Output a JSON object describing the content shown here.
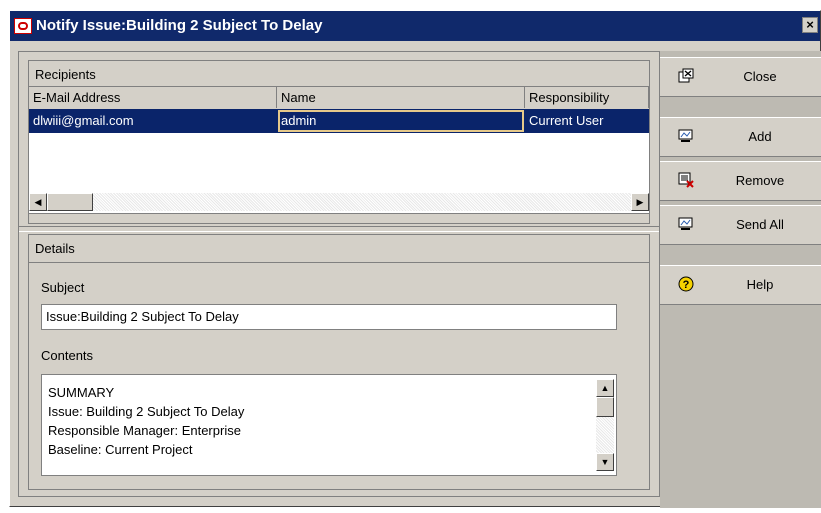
{
  "window": {
    "title": "Notify Issue:Building 2 Subject To Delay"
  },
  "recipients": {
    "header": "Recipients",
    "columns": [
      "E-Mail Address",
      "Name",
      "Responsibility"
    ],
    "rows": [
      {
        "email": "dlwiii@gmail.com",
        "name": "admin",
        "responsibility": "Current User"
      }
    ]
  },
  "details": {
    "header": "Details",
    "subject_label": "Subject",
    "subject_value": "Issue:Building 2 Subject To Delay",
    "contents_label": "Contents",
    "contents_lines": [
      "SUMMARY",
      "Issue:  Building 2 Subject To Delay",
      "Responsible Manager:  Enterprise",
      "Baseline:  Current Project"
    ]
  },
  "buttons": {
    "close": "Close",
    "add": "Add",
    "remove": "Remove",
    "send_all": "Send All",
    "help": "Help"
  },
  "icons": {
    "close": "close-window-icon",
    "add": "add-recipient-icon",
    "remove": "remove-recipient-icon",
    "send_all": "send-all-icon",
    "help": "help-icon"
  },
  "colors": {
    "titlebar": "#10296b",
    "selection": "#0a246a",
    "panel": "#d4d0c8"
  }
}
